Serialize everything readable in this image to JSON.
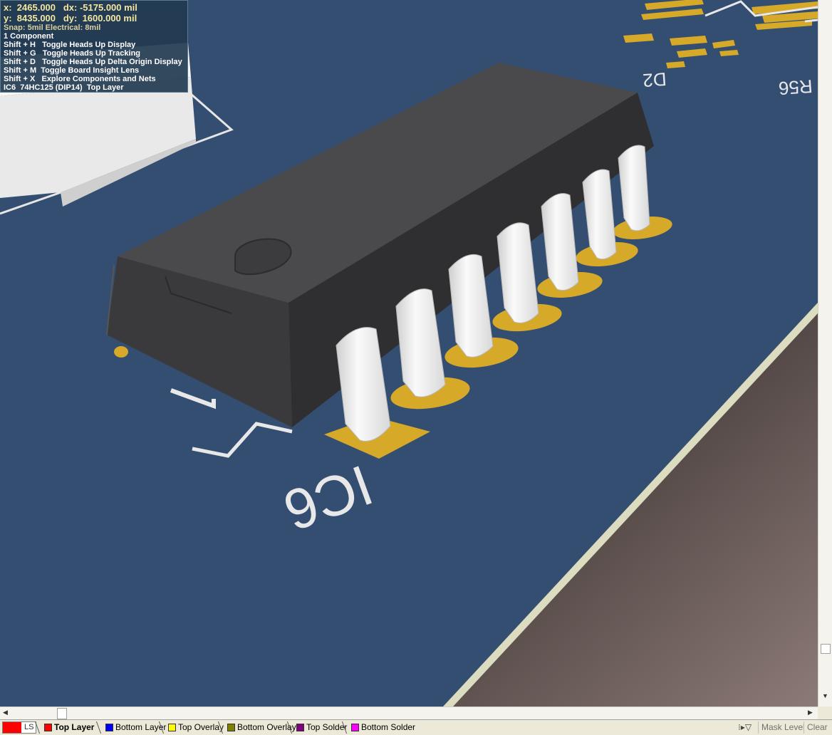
{
  "hud": {
    "x_line": "x:  2465.000   dx: -5175.000 mil",
    "y_line": "y:  8435.000   dy:  1600.000 mil",
    "snap_line": "Snap: 5mil Electrical: 8mil",
    "component_count": "1 Component",
    "shortcuts": [
      "Shift + H   Toggle Heads Up Display",
      "Shift + G   Toggle Heads Up Tracking",
      "Shift + D   Toggle Heads Up Delta Origin Display",
      "Shift + M  Toggle Board Insight Lens",
      "Shift + X   Explore Components and Nets"
    ],
    "selection": "IC6  74HC125 (DIP14)  Top Layer"
  },
  "silkscreen": {
    "ic_designator": "IC6",
    "d2_designator": "D2",
    "r_designator": "R56",
    "pad_number": "1"
  },
  "layer_bar": {
    "ls_label": "LS",
    "tabs": [
      {
        "label": "Top Layer",
        "color": "#ff0000",
        "active": true
      },
      {
        "label": "Bottom Layer",
        "color": "#0000ff",
        "active": false
      },
      {
        "label": "Top Overlay",
        "color": "#ffff00",
        "active": false
      },
      {
        "label": "Bottom Overlay",
        "color": "#808000",
        "active": false
      },
      {
        "label": "Top Solder",
        "color": "#800080",
        "active": false
      },
      {
        "label": "Bottom Solder",
        "color": "#ff00ff",
        "active": false
      }
    ],
    "mask_level": "Mask Level",
    "clear": "Clear"
  },
  "colors": {
    "board": "#344e72",
    "pad_gold": "#d6a928",
    "ic_body": "#3a3a3c",
    "silkscreen": "#e8e8e8"
  }
}
